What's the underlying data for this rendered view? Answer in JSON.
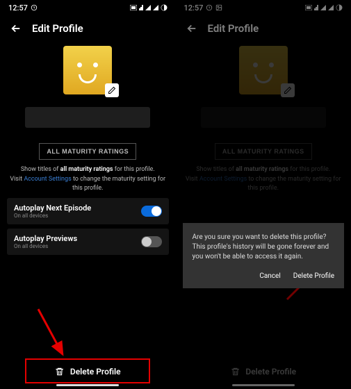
{
  "status": {
    "time": "12:57"
  },
  "header": {
    "title": "Edit Profile"
  },
  "name_field": {
    "value": ""
  },
  "maturity": {
    "button": "ALL MATURITY RATINGS",
    "line1_pre": "Show titles of ",
    "line1_strong": "all maturity ratings",
    "line1_post": " for this profile.",
    "line2_pre": "Visit ",
    "line2_link": "Account Settings",
    "line2_post": " to change the maturity setting for this profile."
  },
  "toggles": [
    {
      "label": "Autoplay Next Episode",
      "sub": "On all devices",
      "on": true
    },
    {
      "label": "Autoplay Previews",
      "sub": "On all devices",
      "on": false
    }
  ],
  "delete": {
    "label": "Delete Profile"
  },
  "dialog": {
    "message": "Are you sure you want to delete this profile? This profile's history will be gone forever and you won't be able to access it again.",
    "cancel": "Cancel",
    "confirm": "Delete Profile"
  }
}
